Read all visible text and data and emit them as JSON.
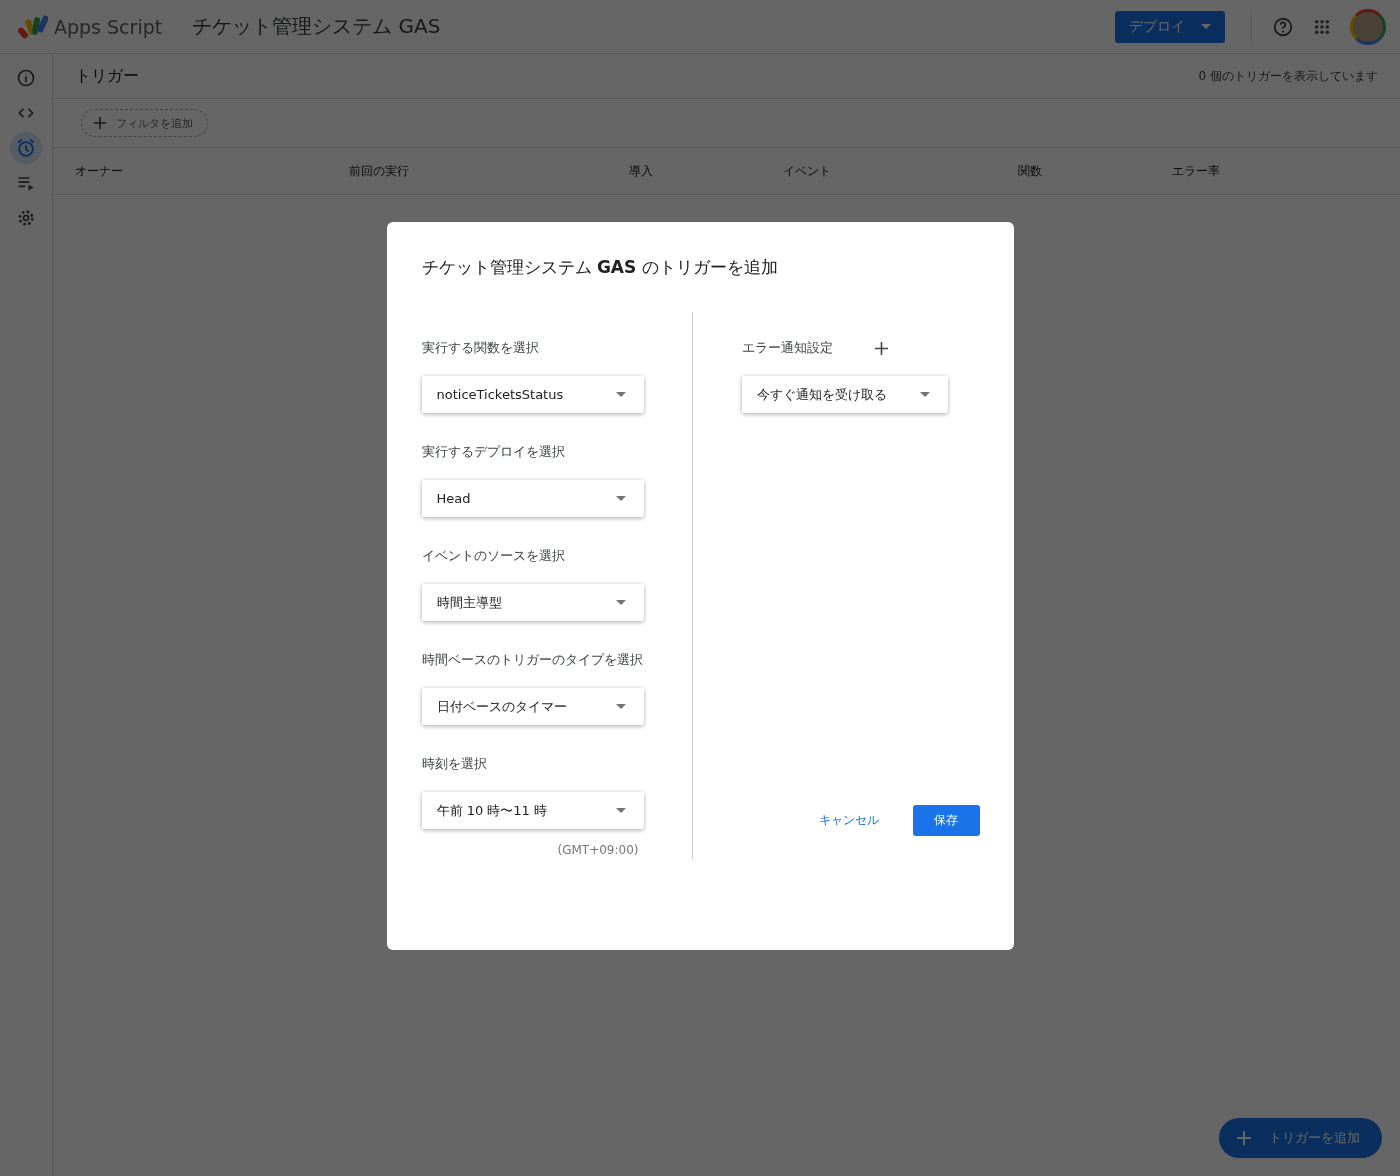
{
  "header": {
    "product": "Apps Script",
    "project": "チケット管理システム GAS",
    "deploy_button": "デプロイ"
  },
  "sidebar": {
    "items": [
      {
        "kind": "info",
        "selected": false
      },
      {
        "kind": "code",
        "selected": false
      },
      {
        "kind": "alarm",
        "selected": true
      },
      {
        "kind": "executions",
        "selected": false
      },
      {
        "kind": "settings",
        "selected": false
      }
    ]
  },
  "page": {
    "title": "トリガー",
    "count": "0 個のトリガーを表示しています",
    "filter_button": "フィルタを追加"
  },
  "table": {
    "columns": [
      "オーナー",
      "前回の実行",
      "導入",
      "イベント",
      "関数",
      "エラー率"
    ]
  },
  "fab": {
    "label": "トリガーを追加"
  },
  "dialog": {
    "title": "チケット管理システム **GAS** のトリガーを追加",
    "fields": [
      {
        "label": "実行する関数を選択",
        "value": "noticeTicketsStatus"
      },
      {
        "label": "実行するデプロイを選択",
        "value": "Head"
      },
      {
        "label": "イベントのソースを選択",
        "value": "時間主導型"
      },
      {
        "label": "時間ベースのトリガーのタイプを選択",
        "value": "日付ベースのタイマー"
      },
      {
        "label": "時刻を選択",
        "value": "午前 10 時〜11 時",
        "note": "(GMT+09:00)"
      }
    ],
    "notification": {
      "label": "エラー通知設定",
      "value": "今すぐ通知を受け取る"
    },
    "buttons": [
      {
        "kind": "text",
        "label": "キャンセル"
      },
      {
        "kind": "primary",
        "label": "保存"
      }
    ]
  }
}
